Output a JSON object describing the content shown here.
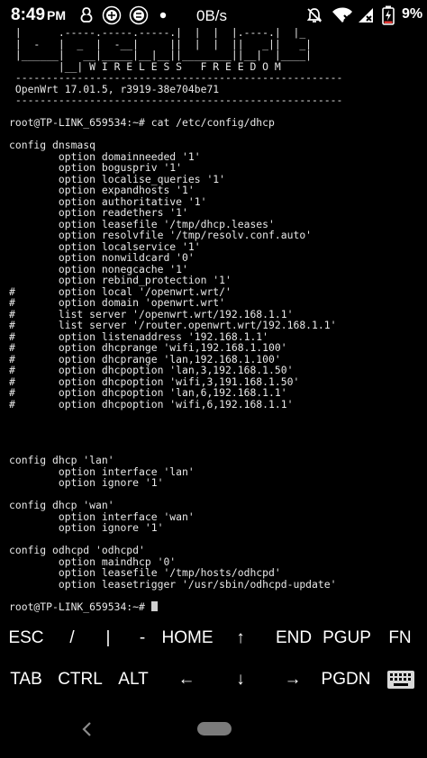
{
  "status_bar": {
    "time": "8:49",
    "ampm": "PM",
    "speed": "0B/s",
    "battery": "9%",
    "icons": [
      "gesture-icon",
      "app-icon-1",
      "app-icon-2",
      "dot-icon",
      "notifications-off-icon",
      "wifi-off-icon",
      "cellular-off-icon",
      "battery-charging-icon"
    ],
    "colors": {
      "battery_charge": "#e53935",
      "battery_frame": "#ffffff"
    }
  },
  "terminal": {
    "lines": [
      " |      .-----.-----.-----.|  |  |  |.----.|  |_",
      " |  -   |  _  |  -__|     ||  |  |  ||   _||   _|",
      " |______|   __|_____|__|__||________||__|  |____|",
      "        |__| W I R E L E S S   F R E E D O M",
      " -----------------------------------------------------",
      " OpenWrt 17.01.5, r3919-38e704be71",
      " -----------------------------------------------------",
      "",
      "root@TP-LINK_659534:~# cat /etc/config/dhcp",
      "",
      "config dnsmasq",
      "        option domainneeded '1'",
      "        option boguspriv '1'",
      "        option localise_queries '1'",
      "        option expandhosts '1'",
      "        option authoritative '1'",
      "        option readethers '1'",
      "        option leasefile '/tmp/dhcp.leases'",
      "        option resolvfile '/tmp/resolv.conf.auto'",
      "        option localservice '1'",
      "        option nonwildcard '0'",
      "        option nonegcache '1'",
      "        option rebind_protection '1'",
      "#       option local '/openwrt.wrt/'",
      "#       option domain 'openwrt.wrt'",
      "#       list server '/openwrt.wrt/192.168.1.1'",
      "#       list server '/router.openwrt.wrt/192.168.1.1'",
      "#       option listenaddress '192.168.1.1'",
      "#       option dhcprange 'wifi,192.168.1.100'",
      "#       option dhcprange 'lan,192.168.1.100'",
      "#       option dhcpoption 'lan,3,192.168.1.50'",
      "#       option dhcpoption 'wifi,3,191.168.1.50'",
      "#       option dhcpoption 'lan,6,192.168.1.1'",
      "#       option dhcpoption 'wifi,6,192.168.1.1'",
      "",
      "",
      "",
      "",
      "config dhcp 'lan'",
      "        option interface 'lan'",
      "        option ignore '1'",
      "",
      "config dhcp 'wan'",
      "        option interface 'wan'",
      "        option ignore '1'",
      "",
      "config odhcpd 'odhcpd'",
      "        option maindhcp '0'",
      "        option leasefile '/tmp/hosts/odhcpd'",
      "        option leasetrigger '/usr/sbin/odhcpd-update'",
      ""
    ],
    "prompt": "root@TP-LINK_659534:~# "
  },
  "extra_keys": {
    "row1": [
      "ESC",
      "/",
      "|",
      "-",
      "HOME",
      "↑",
      "END",
      "PGUP",
      "FN"
    ],
    "row2": [
      "TAB",
      "CTRL",
      "ALT",
      "←",
      "↓",
      "→",
      "PGDN",
      "keyboard-icon"
    ]
  },
  "nav": {
    "back_icon": "back-chevron-icon",
    "home_icon": "home-pill-icon"
  }
}
